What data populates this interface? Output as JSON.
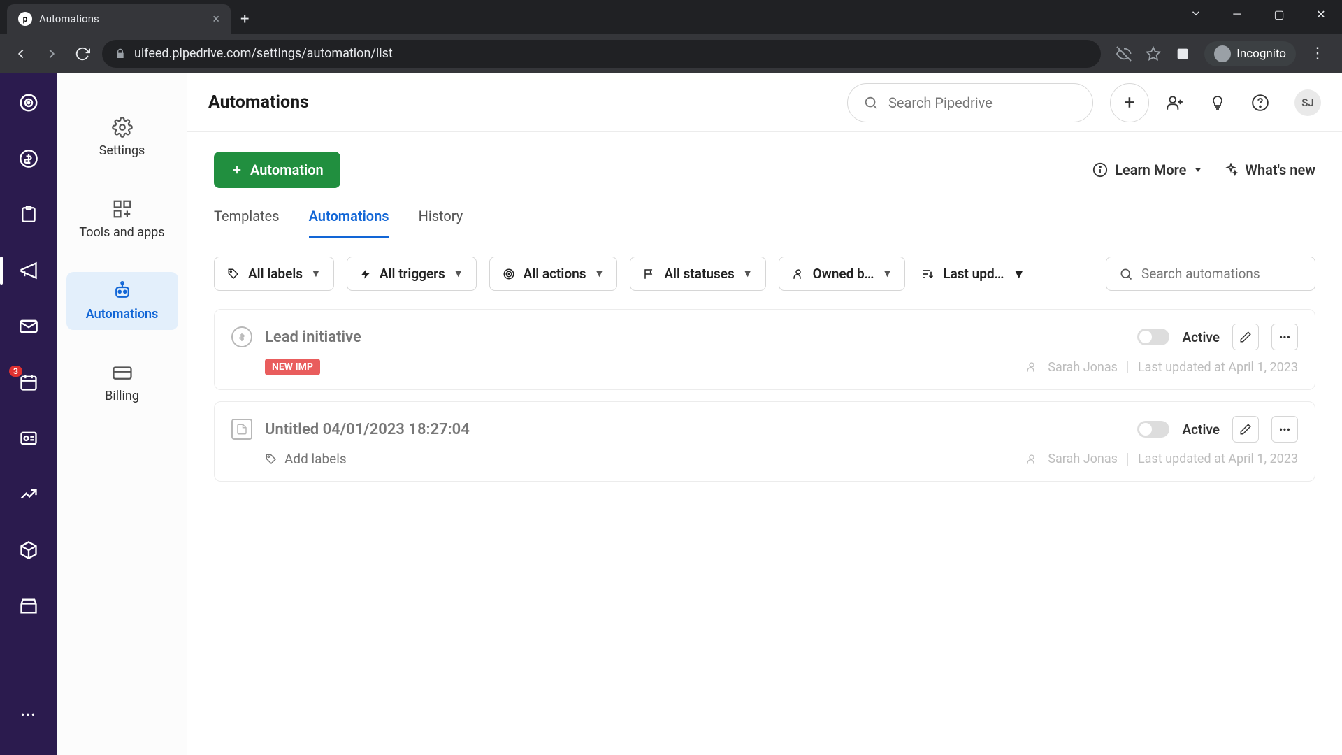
{
  "browser": {
    "tab_title": "Automations",
    "url": "uifeed.pipedrive.com/settings/automation/list",
    "incognito_label": "Incognito"
  },
  "rail": {
    "badge_count": "3"
  },
  "sub_sidebar": {
    "items": [
      {
        "label": "Settings"
      },
      {
        "label": "Tools and apps"
      },
      {
        "label": "Automations"
      },
      {
        "label": "Billing"
      }
    ]
  },
  "header": {
    "title": "Automations",
    "search_placeholder": "Search Pipedrive",
    "avatar_initials": "SJ"
  },
  "toolbar": {
    "automation_button": "Automation",
    "learn_more": "Learn More",
    "whats_new": "What's new"
  },
  "tabs": [
    {
      "label": "Templates"
    },
    {
      "label": "Automations"
    },
    {
      "label": "History"
    }
  ],
  "filters": {
    "labels": "All labels",
    "triggers": "All triggers",
    "actions": "All actions",
    "statuses": "All statuses",
    "owned": "Owned b…",
    "sort": "Last upd…",
    "search_placeholder": "Search automations"
  },
  "automations": [
    {
      "title": "Lead initiative",
      "badge": "NEW IMP",
      "status": "Active",
      "owner": "Sarah Jonas",
      "updated": "Last updated at April 1, 2023"
    },
    {
      "title": "Untitled 04/01/2023 18:27:04",
      "add_labels": "Add labels",
      "status": "Active",
      "owner": "Sarah Jonas",
      "updated": "Last updated at April 1, 2023"
    }
  ]
}
